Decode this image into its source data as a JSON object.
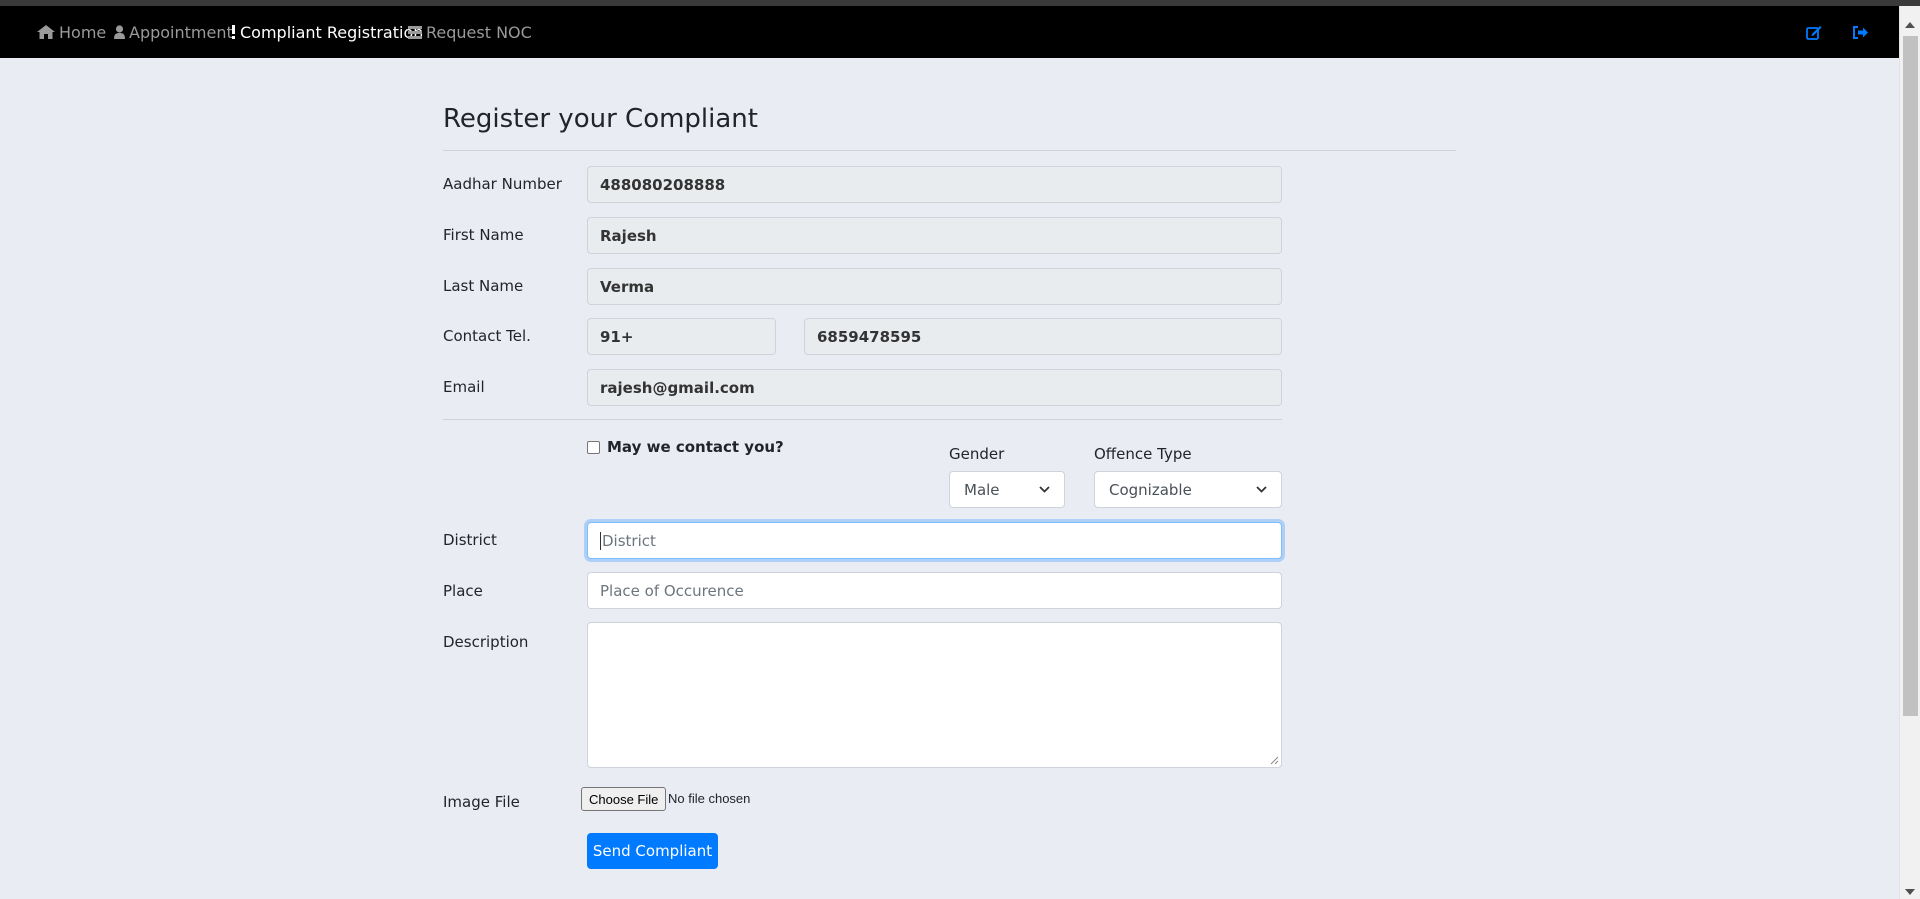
{
  "nav": {
    "items": [
      {
        "label": "Home",
        "icon": "home-icon"
      },
      {
        "label": "Appointment",
        "icon": "user-icon"
      },
      {
        "label": "Compliant Registration",
        "icon": "exclamation-icon",
        "active": true
      },
      {
        "label": "Request NOC",
        "icon": "list-icon"
      }
    ],
    "right_icons": [
      "edit-icon",
      "sign-out-icon"
    ],
    "accent": "#007bff"
  },
  "form": {
    "title": "Register your Compliant",
    "aadhar": {
      "label": "Aadhar Number",
      "value": "488080208888"
    },
    "first_name": {
      "label": "First Name",
      "value": "Rajesh"
    },
    "last_name": {
      "label": "Last Name",
      "value": "Verma"
    },
    "contact": {
      "label": "Contact Tel.",
      "code": "91+",
      "number": "6859478595"
    },
    "email": {
      "label": "Email",
      "value": "rajesh@gmail.com"
    },
    "contact_opt": {
      "label": "May we contact you?",
      "checked": false
    },
    "gender": {
      "label": "Gender",
      "value": "Male"
    },
    "offence": {
      "label": "Offence Type",
      "value": "Cognizable"
    },
    "district": {
      "label": "District",
      "placeholder": "District"
    },
    "place": {
      "label": "Place",
      "placeholder": "Place of Occurence"
    },
    "description": {
      "label": "Description"
    },
    "image": {
      "label": "Image File",
      "button": "Choose File",
      "status": "No file chosen"
    },
    "submit": "Send Compliant"
  }
}
